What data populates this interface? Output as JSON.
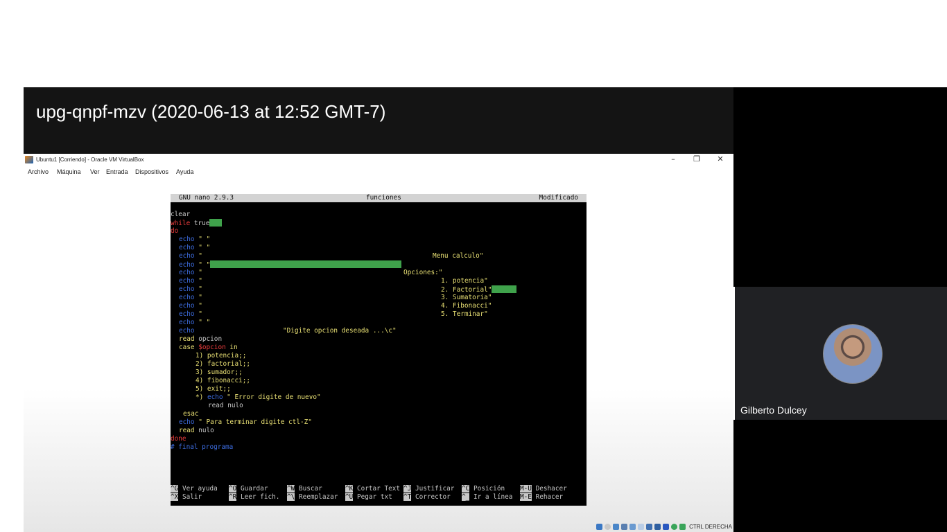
{
  "meeting": {
    "title": "upg-qnpf-mzv (2020-06-13 at 12:52 GMT-7)",
    "participant_name": "Gilberto Dulcey"
  },
  "vbox": {
    "window_title": "Ubuntu1 [Corriendo] - Oracle VM VirtualBox",
    "controls": {
      "minimize": "–",
      "restore": "❐",
      "close": "✕"
    },
    "menu": [
      "Archivo",
      "Máquina",
      "Ver",
      "Entrada",
      "Dispositivos",
      "Ayuda"
    ],
    "host_key": "CTRL DERECHA"
  },
  "nano": {
    "version": "GNU nano 2.9.3",
    "filename": "funciones",
    "status": "Modificado",
    "lines": {
      "l01": "clear",
      "l02a": "while",
      "l02b": " true",
      "l03": "do",
      "echo": "echo",
      "q": "\" \"",
      "q_open": "\"",
      "l07_text": "Menu calculo\"",
      "l09_text": "Opciones:\"",
      "l10_text": "1. potencia\"",
      "l11_text": "2. Factorial\"",
      "l12_text": "3. Sumatoria\"",
      "l13_text": "4. Fibonacci\"",
      "l14_text": "5. Terminar\"",
      "l16_text": "\"Digite opcion deseada ...\\c\"",
      "read": "read",
      "l17_arg": " opcion",
      "case": "case",
      "l18_var": " $opcion",
      "l18_in": " in",
      "c1": "1) potencia;;",
      "c2": "2) factorial;;",
      "c3": "3) sumador;;",
      "c4": "4) fibonacci;;",
      "c5": "5) exit;;",
      "c6_pre": "*) ",
      "c6_str": " \" Error digite de nuevo\"",
      "c6_read": "read nulo",
      "esac": "esac",
      "l26_str": " \" Para terminar digite ctl-Z\"",
      "l27_arg": " nulo",
      "done": "done",
      "comment": "# final programa"
    },
    "shortcuts": [
      {
        "key": "^G",
        "label": "Ver ayuda"
      },
      {
        "key": "^O",
        "label": "Guardar"
      },
      {
        "key": "^W",
        "label": "Buscar"
      },
      {
        "key": "^K",
        "label": "Cortar Text"
      },
      {
        "key": "^J",
        "label": "Justificar"
      },
      {
        "key": "^C",
        "label": "Posición"
      },
      {
        "key": "M-U",
        "label": "Deshacer"
      },
      {
        "key": "^X",
        "label": "Salir"
      },
      {
        "key": "^R",
        "label": "Leer fich."
      },
      {
        "key": "^\\",
        "label": "Reemplazar"
      },
      {
        "key": "^U",
        "label": "Pegar txt"
      },
      {
        "key": "^T",
        "label": "Corrector"
      },
      {
        "key": "^_",
        "label": "Ir a línea"
      },
      {
        "key": "M-E",
        "label": "Rehacer"
      }
    ]
  },
  "colors": {
    "highlight": "#3fa24b",
    "keyword": "#ef3e3e",
    "echo": "#3d6de0",
    "string": "#e9e074"
  }
}
